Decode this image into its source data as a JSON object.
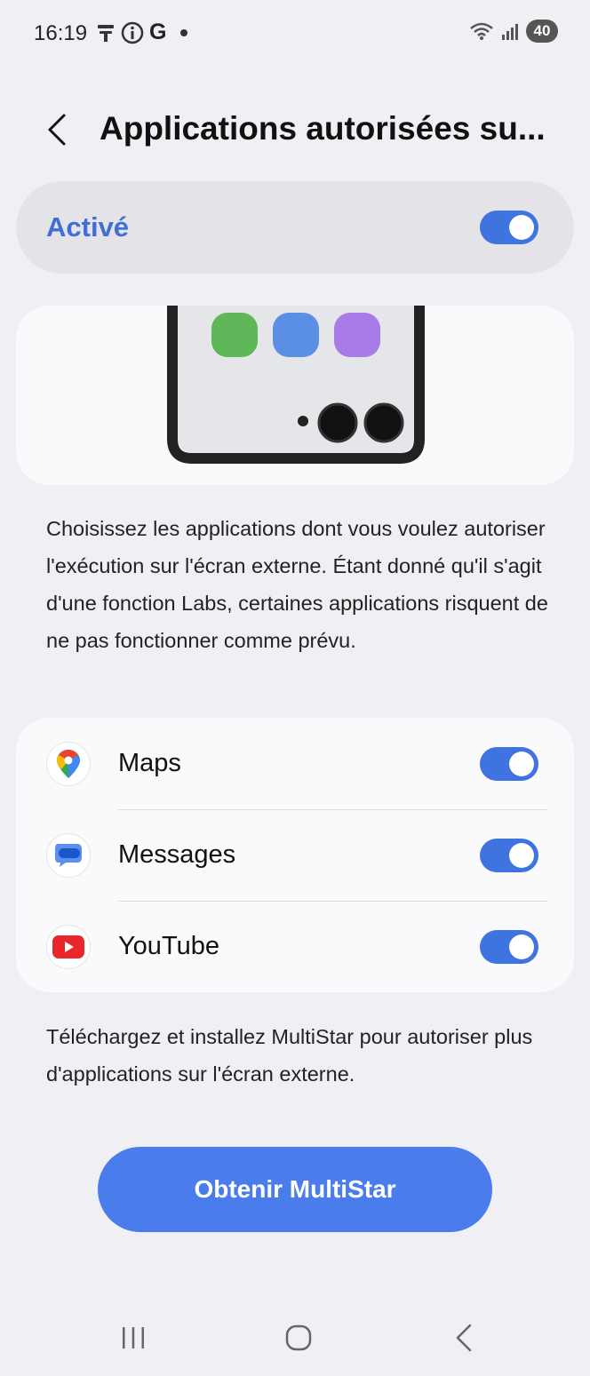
{
  "status_bar": {
    "time": "16:19",
    "google_letter": "G",
    "battery": "40",
    "icons": [
      "notification-flag-icon",
      "info-circle-icon",
      "google-icon",
      "dot-icon",
      "wifi-icon",
      "signal-icon",
      "battery-icon"
    ]
  },
  "header": {
    "title": "Applications autorisées su..."
  },
  "master_switch": {
    "label": "Activé",
    "on": true
  },
  "illustration": {
    "app_colors": [
      "#5fb75a",
      "#5b8fe3",
      "#a77be8"
    ],
    "frame_color": "#222222",
    "screen_color": "#e5e6ea"
  },
  "description": "Choisissez les applications dont vous voulez autoriser l'exécution sur l'écran externe. Étant donné qu'il s'agit d'une fonction Labs, certaines applications risquent de ne pas fonctionner comme prévu.",
  "apps": [
    {
      "label": "Maps",
      "icon": "google-maps-icon",
      "on": true
    },
    {
      "label": "Messages",
      "icon": "google-messages-icon",
      "on": true
    },
    {
      "label": "YouTube",
      "icon": "youtube-icon",
      "on": true
    }
  ],
  "footer_note": "Téléchargez et installez MultiStar pour autoriser plus d'applications sur l'écran externe.",
  "cta": {
    "label": "Obtenir MultiStar"
  },
  "colors": {
    "accent": "#3e73e0",
    "button": "#4a7cec",
    "background": "#f0f0f4",
    "card": "#fafafc"
  },
  "nav_bar": {
    "icons": [
      "recent-apps-icon",
      "home-icon",
      "back-nav-icon"
    ]
  }
}
